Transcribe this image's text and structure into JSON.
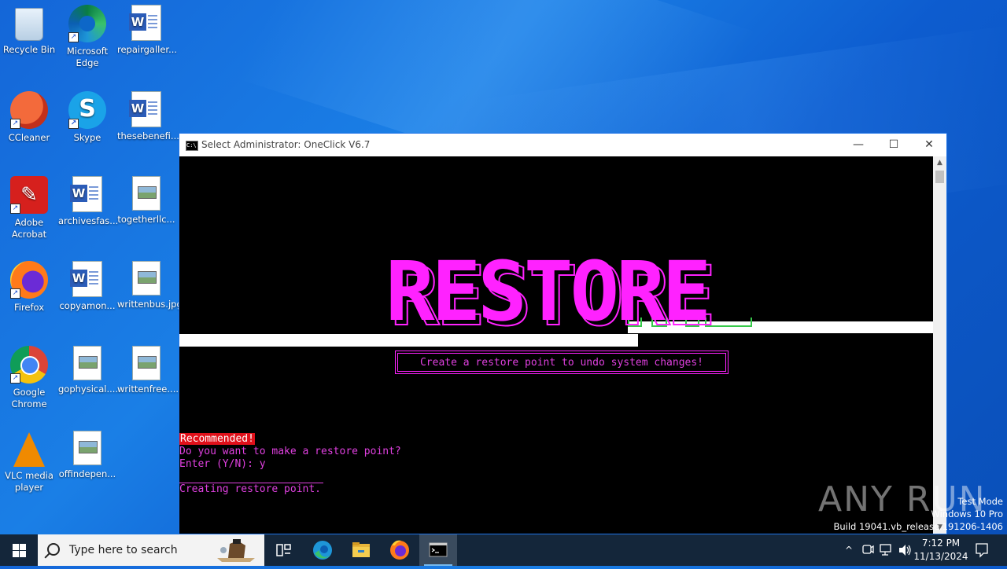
{
  "desktop": {
    "icons": [
      {
        "label": "Recycle Bin",
        "icon": "recycle-bin-icon"
      },
      {
        "label": "Microsoft Edge",
        "icon": "edge-icon"
      },
      {
        "label": "repairgaller...",
        "icon": "word-document-icon"
      },
      {
        "label": "CCleaner",
        "icon": "ccleaner-icon"
      },
      {
        "label": "Skype",
        "icon": "skype-icon"
      },
      {
        "label": "thesebenefi...",
        "icon": "word-document-icon"
      },
      {
        "label": "Adobe Acrobat",
        "icon": "acrobat-icon"
      },
      {
        "label": "archivesfas...",
        "icon": "word-document-icon"
      },
      {
        "label": "togetherllc...",
        "icon": "image-file-icon"
      },
      {
        "label": "Firefox",
        "icon": "firefox-icon"
      },
      {
        "label": "copyamon...",
        "icon": "word-document-icon"
      },
      {
        "label": "writtenbus.jpg",
        "icon": "image-file-icon"
      },
      {
        "label": "Google Chrome",
        "icon": "chrome-icon"
      },
      {
        "label": "gophysical....",
        "icon": "image-file-icon"
      },
      {
        "label": "writtenfree....",
        "icon": "image-file-icon"
      },
      {
        "label": "VLC media player",
        "icon": "vlc-icon"
      },
      {
        "label": "offindepen...",
        "icon": "image-file-icon"
      }
    ]
  },
  "console": {
    "title": "Select Administrator:  OneClick V6.7",
    "banner": "RESTORE",
    "subtitle": "Create a restore point to undo system changes!",
    "recommended": "Recommended!",
    "question": "Do you want to make a restore point?",
    "prompt": "Enter (Y/N): y",
    "status": "Creating restore point.",
    "minimize_glyph": "—",
    "maximize_glyph": "☐",
    "close_glyph": "✕",
    "scroll_up_glyph": "▲",
    "scroll_down_glyph": "▼",
    "cmd_glyph": "C:\\"
  },
  "watermark": {
    "brand": "ANY  RUN",
    "test_mode": "Test Mode",
    "os_line": "Windows 10 Pro",
    "build_line": "Build 19041.vb_release.191206-1406"
  },
  "taskbar": {
    "search_placeholder": "Type here to search",
    "time": "7:12 PM",
    "date": "11/13/2024",
    "tray_chevron": "^",
    "colors": {
      "bar": "#14263a",
      "accent": "#76b9ed"
    }
  },
  "colors": {
    "console_magenta": "#e040e0",
    "banner_magenta": "#ff22ff",
    "recommended_bg": "#e0101a",
    "desktop_blue": "#1466d8"
  }
}
